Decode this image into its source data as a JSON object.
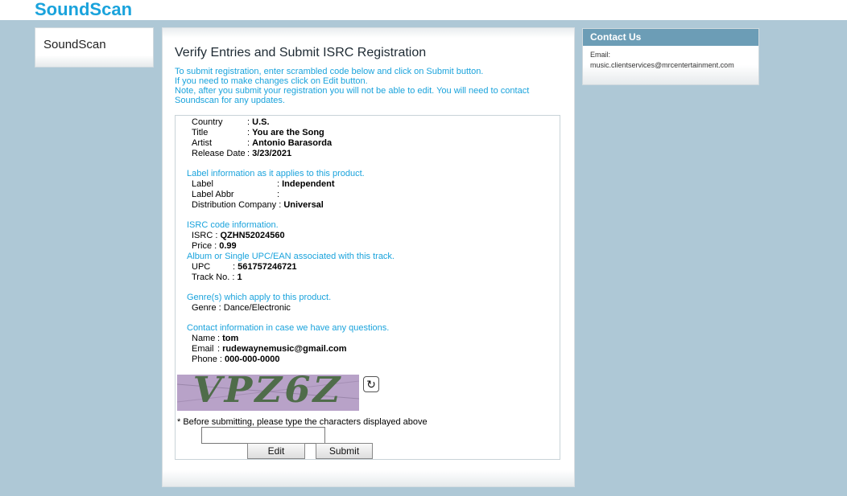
{
  "header": {
    "brand": "SoundScan"
  },
  "sidebar": {
    "title": "SoundScan"
  },
  "main": {
    "title": "Verify Entries and Submit ISRC Registration",
    "intro": [
      "To submit registration, enter scrambled code below and click on Submit button.",
      "If you need to make changes click on Edit button.",
      "Note, after you submit your registration you will not be able to edit. You will need to contact",
      "Soundscan for any updates."
    ]
  },
  "product": {
    "country_label": "Country",
    "country_value": "U.S.",
    "title_label": "Title",
    "title_value": "You are the Song",
    "artist_label": "Artist",
    "artist_value": "Antonio Barasorda",
    "release_label": "Release Date",
    "release_value": "3/23/2021"
  },
  "label_info": {
    "heading": "Label information as it applies to this product.",
    "label_label": "Label",
    "label_value": "Independent",
    "abbr_label": "Label Abbr",
    "abbr_value": "",
    "dist_label": "Distribution Company",
    "dist_value": "Universal"
  },
  "isrc_info": {
    "heading": "ISRC code information.",
    "isrc_label": "ISRC",
    "isrc_value": "QZHN52024560",
    "price_label": "Price",
    "price_value": "0.99"
  },
  "upc_info": {
    "heading": "Album or Single UPC/EAN associated with this track.",
    "upc_label": "UPC",
    "upc_value": "561757246721",
    "track_label": "Track No.",
    "track_value": "1"
  },
  "genre_info": {
    "heading": "Genre(s) which apply to this product.",
    "genre_label": "Genre",
    "genre_value": "Dance/Electronic"
  },
  "contact_info": {
    "heading": "Contact information in case we have any questions.",
    "name_label": "Name",
    "name_value": "tom",
    "email_label": "Email",
    "email_value": "rudewaynemusic@gmail.com",
    "phone_label": "Phone",
    "phone_value": "000-000-0000"
  },
  "captcha": {
    "text": "VPZ6Z",
    "refresh_icon": "refresh-icon",
    "note": "* Before submitting, please type the characters displayed above",
    "input_value": "",
    "input_placeholder": ""
  },
  "buttons": {
    "edit": "Edit",
    "submit": "Submit"
  },
  "contact_box": {
    "title": "Contact Us",
    "email_label": "Email:",
    "email": "music.clientservices@mrcentertainment.com"
  },
  "colors": {
    "accent": "#1aa3dc",
    "background": "#aec8d6",
    "contact_header": "#6c9db6"
  }
}
